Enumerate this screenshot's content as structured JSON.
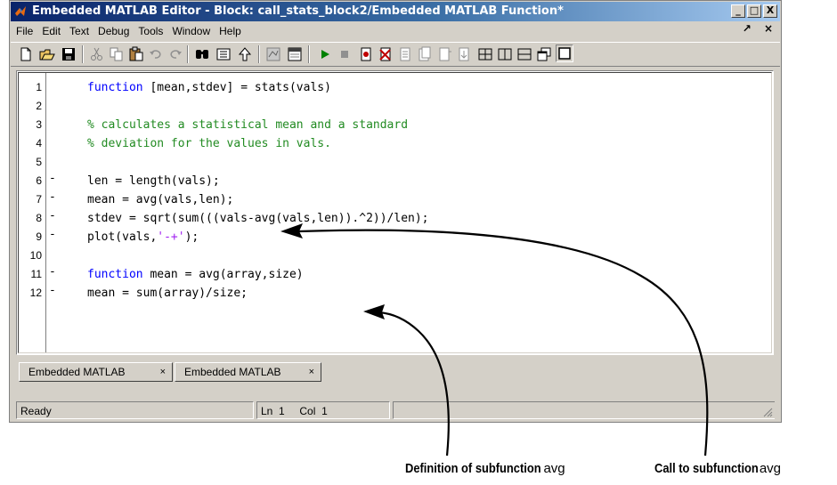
{
  "window": {
    "title": "Embedded MATLAB Editor - Block: call_stats_block2/Embedded MATLAB Function*",
    "buttons": [
      "_",
      "□",
      "X"
    ]
  },
  "menubar": {
    "items": [
      "File",
      "Edit",
      "Text",
      "Debug",
      "Tools",
      "Window",
      "Help"
    ],
    "right": [
      "↗",
      "×"
    ]
  },
  "toolbar": {
    "icons": [
      "new-file-icon",
      "open-folder-icon",
      "save-icon",
      "cut-icon",
      "copy-icon",
      "paste-icon",
      "undo-icon",
      "redo-icon",
      "find-icon",
      "goto-icon",
      "up-arrow-icon",
      "model-icon",
      "data-icon",
      "run-icon",
      "stop-icon",
      "set-breakpoint-icon",
      "clear-breakpoint-icon",
      "step-icon",
      "step-in-icon",
      "step-out-icon",
      "continue-icon",
      "tile-icon",
      "split-vertical-icon",
      "split-horizontal-icon",
      "float-icon",
      "maximize-icon"
    ]
  },
  "editor": {
    "lines": [
      {
        "num": "1",
        "dash": "",
        "code": [
          {
            "t": "function",
            "c": "kw"
          },
          {
            "t": " [mean,stdev] = stats(vals)",
            "c": ""
          }
        ]
      },
      {
        "num": "2",
        "dash": "",
        "code": []
      },
      {
        "num": "3",
        "dash": "",
        "code": [
          {
            "t": "% calculates a statistical mean and a standard",
            "c": "cm"
          }
        ]
      },
      {
        "num": "4",
        "dash": "",
        "code": [
          {
            "t": "% deviation for the values in vals.",
            "c": "cm"
          }
        ]
      },
      {
        "num": "5",
        "dash": "",
        "code": []
      },
      {
        "num": "6",
        "dash": "-",
        "code": [
          {
            "t": "len = length(vals);",
            "c": ""
          }
        ]
      },
      {
        "num": "7",
        "dash": "-",
        "code": [
          {
            "t": "mean = avg(vals,len);",
            "c": ""
          }
        ]
      },
      {
        "num": "8",
        "dash": "-",
        "code": [
          {
            "t": "stdev = sqrt(sum(((vals-avg(vals,len)).^2))/len);",
            "c": ""
          }
        ]
      },
      {
        "num": "9",
        "dash": "-",
        "code": [
          {
            "t": "plot(vals,",
            "c": ""
          },
          {
            "t": "'-+'",
            "c": "st"
          },
          {
            "t": ");",
            "c": ""
          }
        ]
      },
      {
        "num": "10",
        "dash": "",
        "code": []
      },
      {
        "num": "11",
        "dash": "-",
        "code": [
          {
            "t": "function",
            "c": "kw"
          },
          {
            "t": " mean = avg(array,size)",
            "c": ""
          }
        ]
      },
      {
        "num": "12",
        "dash": "-",
        "code": [
          {
            "t": "mean = sum(array)/size;",
            "c": ""
          }
        ]
      }
    ]
  },
  "tabs": [
    {
      "label": "Embedded MATLAB",
      "close": "×"
    },
    {
      "label": "Embedded MATLAB",
      "close": "×"
    }
  ],
  "status": {
    "state": "Ready",
    "ln_label": "Ln",
    "ln_value": "1",
    "col_label": "Col",
    "col_value": "1"
  },
  "callouts": {
    "definition": {
      "caption": "Definition of subfunction",
      "code": "avg"
    },
    "call": {
      "caption": "Call to subfunction",
      "code": "avg"
    }
  },
  "colors": {
    "keyword": "#0000ff",
    "comment": "#228b22",
    "string": "#a020f0",
    "title_bar": "#0a246a"
  }
}
